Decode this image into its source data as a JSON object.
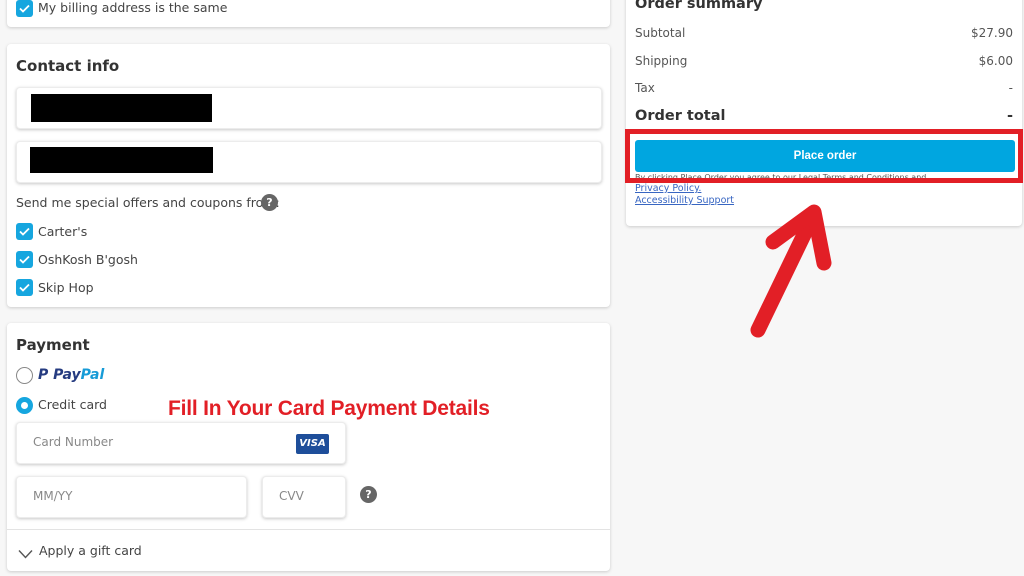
{
  "billing": {
    "same_address_label": "My billing address is the same",
    "same_address_checked": true
  },
  "contact": {
    "title": "Contact info",
    "fields": [
      {
        "value": "[redacted]"
      },
      {
        "value": "[redacted]"
      }
    ],
    "offers_label": "Send me special offers and coupons from:",
    "help_icon": "?",
    "brands": [
      {
        "label": "Carter's",
        "checked": true
      },
      {
        "label": "OshKosh B'gosh",
        "checked": true
      },
      {
        "label": "Skip Hop",
        "checked": true
      }
    ]
  },
  "payment": {
    "title": "Payment",
    "options": [
      {
        "label": "PayPal",
        "logo_parts": [
          "P",
          "Pay",
          "Pal"
        ],
        "selected": false
      },
      {
        "label": "Credit card",
        "selected": true
      }
    ],
    "card_number_placeholder": "Card Number",
    "card_brand": "VISA",
    "expiry_placeholder": "MM/YY",
    "cvv_placeholder": "CVV",
    "cvv_help_icon": "?",
    "gift_card_label": "Apply a gift card"
  },
  "annotation": {
    "text": "Fill In Your Card Payment Details",
    "color": "#e21f26"
  },
  "summary": {
    "title": "Order summary",
    "rows": [
      {
        "label": "Subtotal",
        "value": "$27.90"
      },
      {
        "label": "Shipping",
        "value": "$6.00"
      },
      {
        "label": "Tax",
        "value": "-"
      }
    ],
    "total_label": "Order total",
    "total_value": "-",
    "place_order_label": "Place order",
    "legal_text": "By clicking Place Order you agree to our Legal Terms and Conditions and",
    "links": [
      "Privacy Policy.",
      "Accessibility Support"
    ]
  },
  "colors": {
    "accent": "#16a6df",
    "button": "#00a6e0",
    "highlight": "#e21f26",
    "link": "#3866c2",
    "visa": "#1e4e9a"
  }
}
